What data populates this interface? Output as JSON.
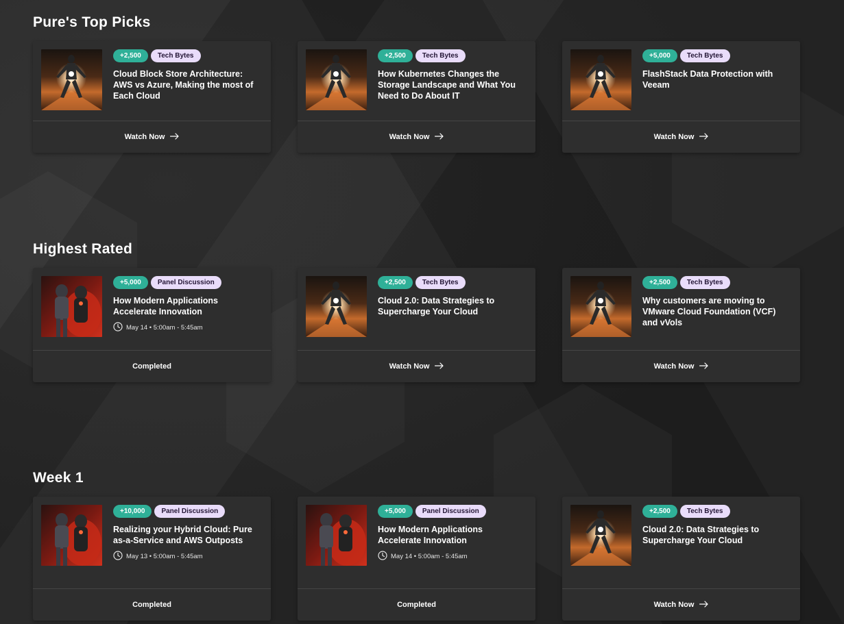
{
  "sections": [
    {
      "title": "Pure's Top Picks",
      "cards": [
        {
          "points": "+2,500",
          "category": "Tech Bytes",
          "title": "Cloud Block Store Architecture: AWS vs Azure, Making the most of Each Cloud",
          "time": "",
          "action": "Watch Now",
          "thumb": "figure-light"
        },
        {
          "points": "+2,500",
          "category": "Tech Bytes",
          "title": "How Kubernetes Changes the Storage Landscape and What You Need to Do About IT",
          "time": "",
          "action": "Watch Now",
          "thumb": "figure-light"
        },
        {
          "points": "+5,000",
          "category": "Tech Bytes",
          "title": "FlashStack Data Protection with Veeam",
          "time": "",
          "action": "Watch Now",
          "thumb": "figure-light"
        }
      ]
    },
    {
      "title": "Highest Rated",
      "cards": [
        {
          "points": "+5,000",
          "category": "Panel Discussion",
          "title": "How Modern Applications Accelerate Innovation",
          "time": "May 14 • 5:00am - 5:45am",
          "action": "Completed",
          "thumb": "figure-red"
        },
        {
          "points": "+2,500",
          "category": "Tech Bytes",
          "title": "Cloud 2.0: Data Strategies to Supercharge Your Cloud",
          "time": "",
          "action": "Watch Now",
          "thumb": "figure-light"
        },
        {
          "points": "+2,500",
          "category": "Tech Bytes",
          "title": "Why customers are moving to VMware Cloud Foundation (VCF) and vVols",
          "time": "",
          "action": "Watch Now",
          "thumb": "figure-light"
        }
      ]
    },
    {
      "title": "Week 1",
      "cards": [
        {
          "points": "+10,000",
          "category": "Panel Discussion",
          "title": "Realizing your Hybrid Cloud: Pure as-a-Service and AWS Outposts",
          "time": "May 13 • 5:00am - 5:45am",
          "action": "Completed",
          "thumb": "figure-red"
        },
        {
          "points": "+5,000",
          "category": "Panel Discussion",
          "title": "How Modern Applications Accelerate Innovation",
          "time": "May 14 • 5:00am - 5:45am",
          "action": "Completed",
          "thumb": "figure-red"
        },
        {
          "points": "+2,500",
          "category": "Tech Bytes",
          "title": "Cloud 2.0: Data Strategies to Supercharge Your Cloud",
          "time": "",
          "action": "Watch Now",
          "thumb": "figure-light"
        }
      ]
    }
  ],
  "colors": {
    "points_badge": "#2fb098",
    "category_badge": "#e9dcfa",
    "card_bg": "#2e2e2e",
    "page_bg": "#242424"
  }
}
